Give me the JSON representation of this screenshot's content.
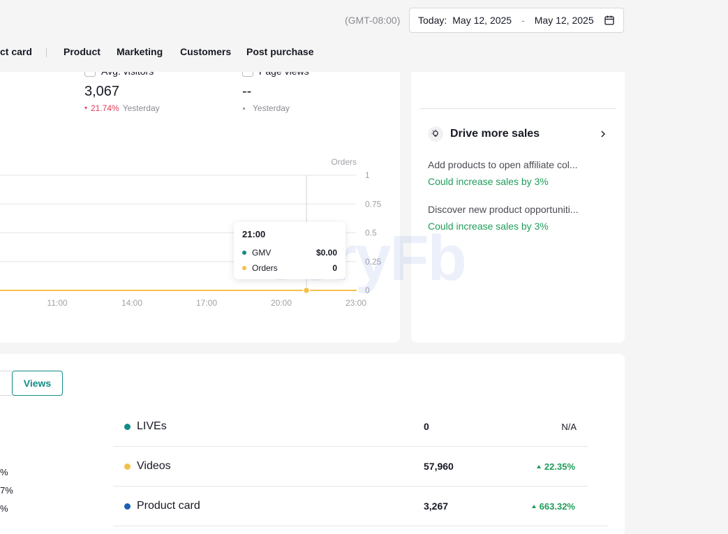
{
  "header": {
    "timezone": "(GMT-08:00)",
    "date_label": "Today:",
    "date_start": "May 12, 2025",
    "date_sep": "-",
    "date_end": "May 12, 2025",
    "calendar_icon": "calendar-icon"
  },
  "nav": {
    "items": [
      "ct card",
      "Product",
      "Marketing",
      "Customers",
      "Post purchase"
    ]
  },
  "metrics": [
    {
      "label": "Avg. visitors",
      "value": "3,067",
      "change": "21.74%",
      "change_direction": "down",
      "compare": "Yesterday"
    },
    {
      "label": "Page views",
      "value": "--",
      "change": "",
      "change_direction": "none",
      "compare": "Yesterday"
    }
  ],
  "chart_data": {
    "type": "line",
    "ylabel": "Orders",
    "yticks": [
      "1",
      "0.75",
      "0.5",
      "0.25",
      "0"
    ],
    "ylim": [
      0,
      1
    ],
    "xticks": [
      "11:00",
      "14:00",
      "17:00",
      "20:00",
      "23:00"
    ],
    "series": [
      {
        "name": "Orders",
        "color": "#f5c04a",
        "values": [
          0,
          0,
          0,
          0,
          0
        ]
      }
    ],
    "hover_x": "21:00",
    "grid": true
  },
  "tooltip": {
    "time": "21:00",
    "rows": [
      {
        "name": "GMV",
        "value": "$0.00",
        "color": "#118c87"
      },
      {
        "name": "Orders",
        "value": "0",
        "color": "#f5c04a"
      }
    ]
  },
  "watermark": "VeryFb",
  "drive": {
    "title": "Drive more sales",
    "icon": "lightbulb-icon",
    "items": [
      {
        "title": "Add products to open affiliate col...",
        "sub": "Could increase sales by 3%"
      },
      {
        "title": "Discover new product opportuniti...",
        "sub": "Could increase sales by 3%"
      }
    ]
  },
  "breakdown": {
    "views_button": "Views",
    "left_percents": [
      "%",
      "7%",
      "%"
    ],
    "rows": [
      {
        "name": "LIVEs",
        "color": "#118c87",
        "value": "0",
        "change": "N/A",
        "dir": "none"
      },
      {
        "name": "Videos",
        "color": "#f5c04a",
        "value": "57,960",
        "change": "22.35%",
        "dir": "up"
      },
      {
        "name": "Product card",
        "color": "#1a5fb4",
        "value": "3,267",
        "change": "663.32%",
        "dir": "up"
      }
    ]
  }
}
